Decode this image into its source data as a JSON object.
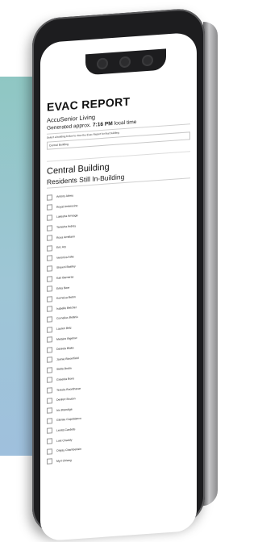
{
  "report": {
    "title": "EVAC REPORT",
    "org": "AccuSenior Living",
    "generated_prefix": "Generated approx.",
    "generated_time": "7:16 PM",
    "generated_suffix": "local time",
    "instructions": "Select a building below to view the Evac Report for that building",
    "select_value": "Central Building"
  },
  "building": {
    "name": "Central Building",
    "subheading": "Residents Still In-Building"
  },
  "residents": [
    "Antony Abreu",
    "Royal Ambrosino",
    "Lakesha Arreaga",
    "Tamisha Ardrey",
    "Rosa Arrellano",
    "Eric Ary",
    "Veronica Athe",
    "Shawni Baisley",
    "Kari Barneras",
    "Erika Beer",
    "Korneisa Behm",
    "Isabelle Belcher",
    "Cornelius Bellinis",
    "Lauren Belz",
    "Melaine Bigelow",
    "Daniela Blake",
    "Jannie Bloomfield",
    "Stella Bodin",
    "Griselda Bono",
    "Teresia Boonthavar",
    "Denfert Bouton",
    "Iris Brandige",
    "Gloriae Capobianco",
    "Lenita Cardells",
    "Loki Chaddy",
    "Orlyay Chamberlain",
    "Myrl Chiang"
  ]
}
